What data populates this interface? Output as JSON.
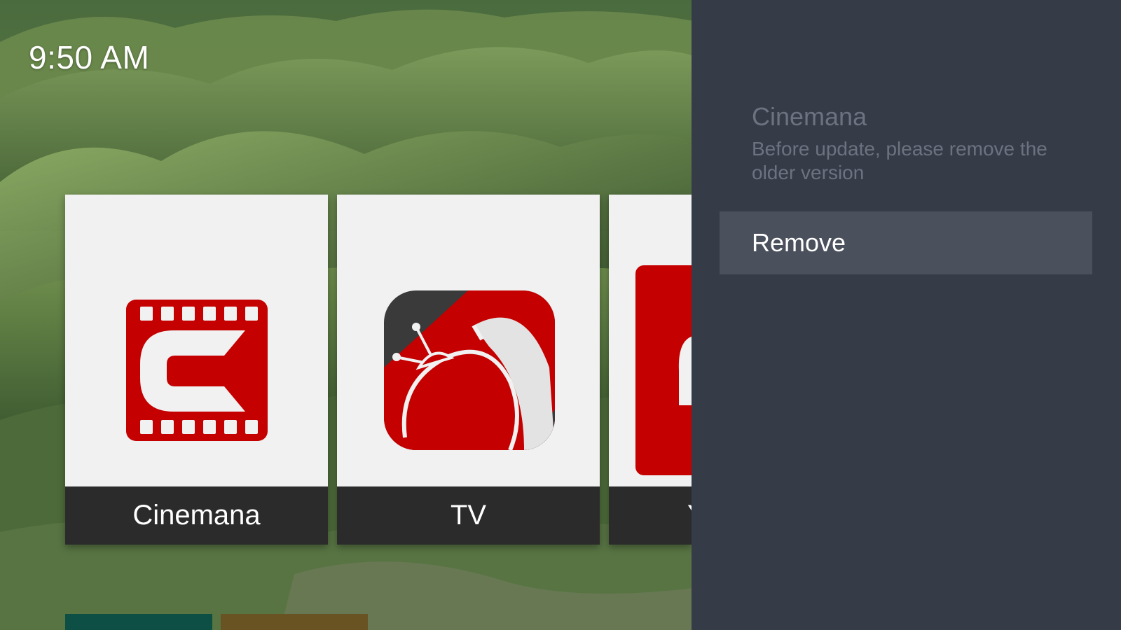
{
  "status_bar": {
    "clock": "9:50 AM"
  },
  "apps": [
    {
      "label": "Cinemana",
      "icon": "cinemana-icon"
    },
    {
      "label": "TV",
      "icon": "tv-satellite-icon"
    },
    {
      "label": "Y",
      "icon": "app-icon-partial"
    }
  ],
  "panel": {
    "title": "Cinemana",
    "message": "Before update, please remove the older version",
    "remove_label": "Remove"
  },
  "colors": {
    "panel_background": "#363b48",
    "button_background": "#4b505d",
    "icon_red": "#c40000",
    "tile_label_background": "#2b2b2b"
  }
}
